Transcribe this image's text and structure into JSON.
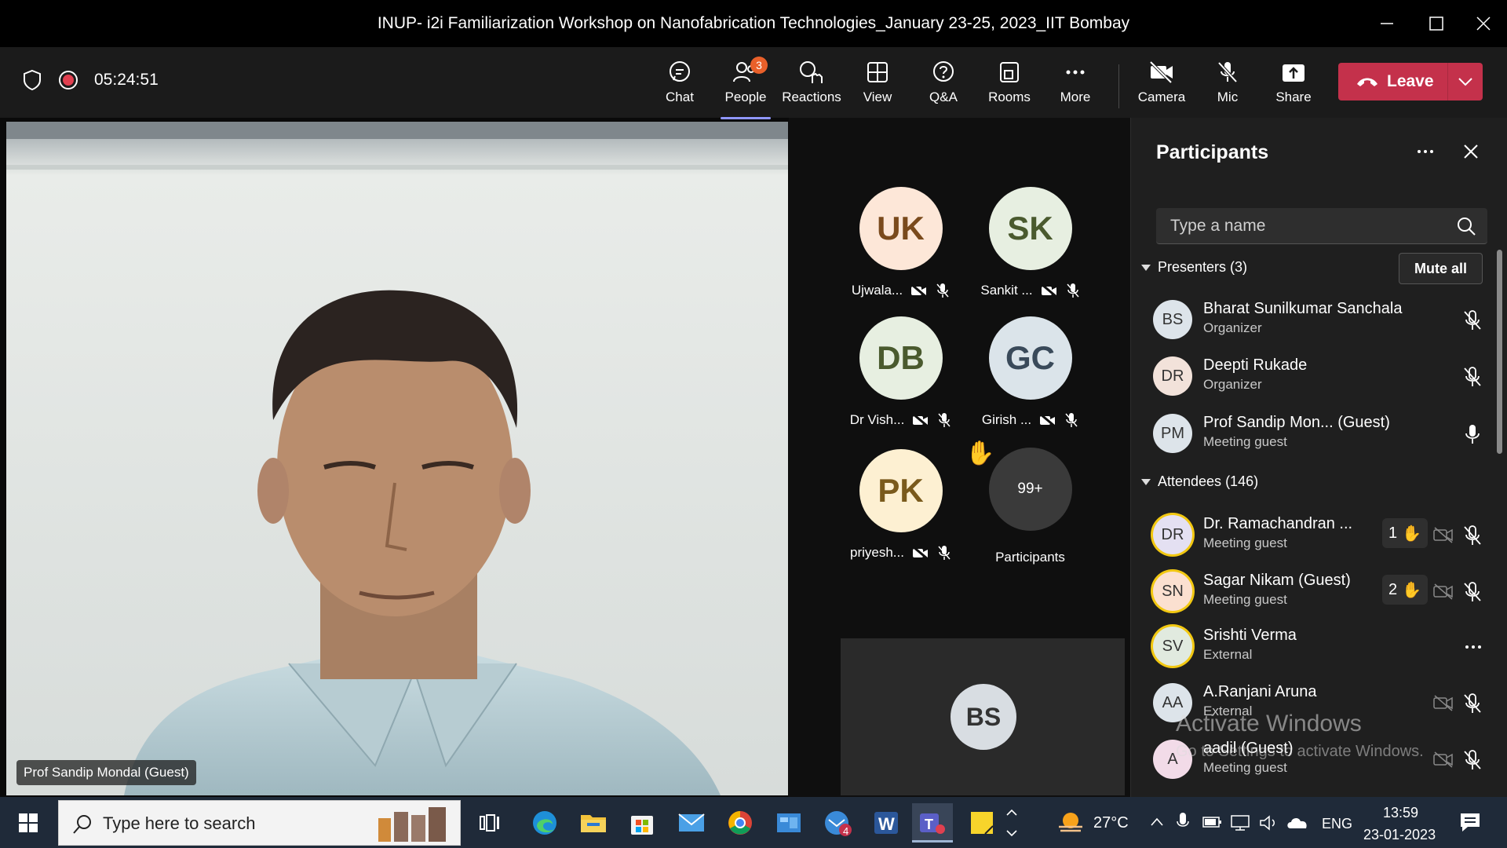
{
  "window": {
    "title": "INUP- i2i Familiarization Workshop on Nanofabrication Technologies_January 23-25, 2023_IIT Bombay"
  },
  "toolbar": {
    "timer": "05:24:51",
    "buttons": [
      {
        "label": "Chat",
        "icon": "chat-icon"
      },
      {
        "label": "People",
        "icon": "people-icon",
        "badge": "3",
        "active": true
      },
      {
        "label": "Reactions",
        "icon": "reactions-icon"
      },
      {
        "label": "View",
        "icon": "view-icon"
      },
      {
        "label": "Q&A",
        "icon": "qna-icon"
      },
      {
        "label": "Rooms",
        "icon": "rooms-icon"
      },
      {
        "label": "More",
        "icon": "more-icon"
      },
      {
        "label": "Camera",
        "icon": "camera-off-icon"
      },
      {
        "label": "Mic",
        "icon": "mic-off-icon"
      },
      {
        "label": "Share",
        "icon": "share-icon"
      }
    ],
    "leave_label": "Leave",
    "leave_color": "#c4314b"
  },
  "video": {
    "speaker_name": "Prof Sandip Mondal (Guest)"
  },
  "gallery": {
    "tiles": [
      {
        "initials": "UK",
        "name": "Ujwala...",
        "bg": "#fde7d8",
        "fg": "#7a4a1c"
      },
      {
        "initials": "SK",
        "name": "Sankit ...",
        "bg": "#e7efe1",
        "fg": "#4a5a2e"
      },
      {
        "initials": "DB",
        "name": "Dr Vish...",
        "bg": "#e7efe1",
        "fg": "#4a5a2e"
      },
      {
        "initials": "GC",
        "name": "Girish ...",
        "bg": "#dbe4ea",
        "fg": "#3a4a5a"
      },
      {
        "initials": "PK",
        "name": "priyesh...",
        "bg": "#fdf0d2",
        "fg": "#7a5a1c"
      }
    ],
    "more_count": "99+",
    "more_label": "Participants",
    "self_initials": "BS"
  },
  "participants": {
    "title": "Participants",
    "search_placeholder": "Type a name",
    "presenters_label": "Presenters (3)",
    "mute_all_label": "Mute all",
    "presenters": [
      {
        "initials": "BS",
        "name": "Bharat Sunilkumar Sanchala",
        "role": "Organizer",
        "bg": "#dde4ea",
        "mic": "muted"
      },
      {
        "initials": "DR",
        "name": "Deepti Rukade",
        "role": "Organizer",
        "bg": "#f2e2da",
        "mic": "muted"
      },
      {
        "initials": "PM",
        "name": "Prof Sandip Mon... (Guest)",
        "role": "Meeting guest",
        "bg": "#dde4ea",
        "mic": "on"
      }
    ],
    "attendees_label": "Attendees (146)",
    "attendees": [
      {
        "initials": "DR",
        "name": "Dr. Ramachandran ...",
        "role": "Meeting guest",
        "bg": "#e4e0f2",
        "hand": "1"
      },
      {
        "initials": "SN",
        "name": "Sagar Nikam (Guest)",
        "role": "Meeting guest",
        "bg": "#fbe0d0",
        "hand": "2"
      },
      {
        "initials": "SV",
        "name": "Srishti Verma",
        "role": "External",
        "bg": "#e1eadf",
        "hand": ""
      },
      {
        "initials": "AA",
        "name": "A.Ranjani Aruna",
        "role": "External",
        "bg": "#dde4ea",
        "hand": ""
      },
      {
        "initials": "A",
        "name": "aadil (Guest)",
        "role": "Meeting guest",
        "bg": "#f2dbe8",
        "hand": ""
      }
    ],
    "watermark_title": "Activate Windows",
    "watermark_sub": "Go to Settings to activate Windows."
  },
  "taskbar": {
    "search_placeholder": "Type here to search",
    "mail_badge": "4",
    "temperature": "27°C",
    "language": "ENG",
    "time": "13:59",
    "date": "23-01-2023"
  }
}
